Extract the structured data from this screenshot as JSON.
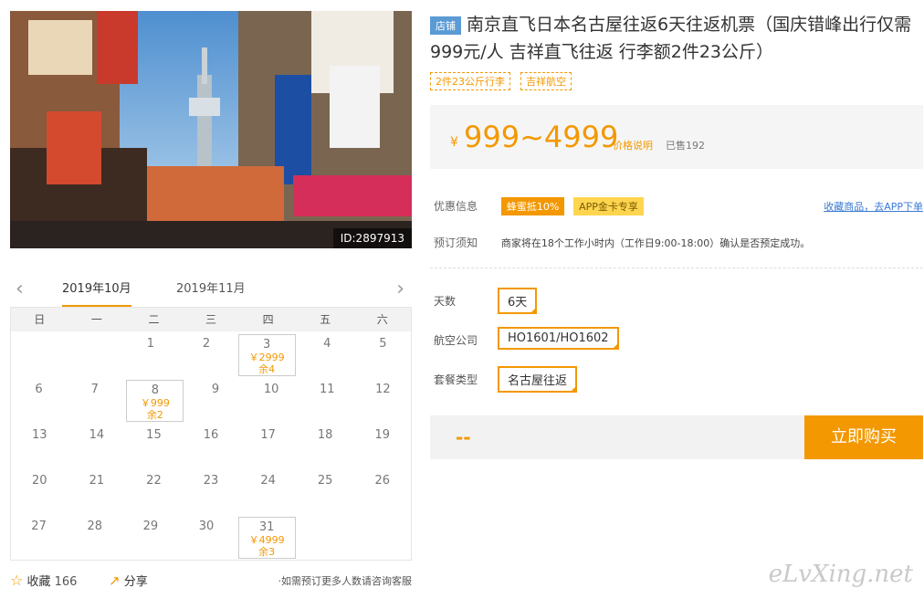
{
  "photo": {
    "id_label": "ID:2897913"
  },
  "calendar": {
    "tab_active": "2019年10月",
    "tab_next": "2019年11月",
    "weekdays": [
      "日",
      "一",
      "二",
      "三",
      "四",
      "五",
      "六"
    ],
    "days": [
      "1",
      "2",
      "3",
      "4",
      "5",
      "6",
      "7",
      "8",
      "9",
      "10",
      "11",
      "12",
      "13",
      "14",
      "15",
      "16",
      "17",
      "18",
      "19",
      "20",
      "21",
      "22",
      "23",
      "24",
      "25",
      "26",
      "27",
      "28",
      "29",
      "30",
      "31"
    ],
    "price_3": "￥2999",
    "left_3": "余4",
    "price_8": "￥999",
    "left_8": "余2",
    "price_31": "￥4999",
    "left_31": "余3"
  },
  "footer": {
    "fav_label": "收藏",
    "fav_count": "166",
    "share_label": "分享",
    "note": "·如需预订更多人数请咨询客服"
  },
  "product": {
    "shop_badge": "店铺",
    "title": "南京直飞日本名古屋往返6天往返机票（国庆错峰出行仅需999元/人 吉祥直飞往返 行李额2件23公斤）",
    "tags": [
      "2件23公斤行李",
      "吉祥航空"
    ]
  },
  "price": {
    "currency": "¥",
    "range": "999~4999",
    "explain": "价格说明",
    "sold": "已售192"
  },
  "promo": {
    "label": "优惠信息",
    "badge1": "蜂蜜抵10%",
    "badge2": "APP金卡专享",
    "app_link": "收藏商品，去APP下单"
  },
  "notice": {
    "label": "预订须知",
    "text": "商家将在18个工作小时内（工作日9:00-18:00）确认是否预定成功。"
  },
  "options": {
    "days_label": "天数",
    "days_value": "6天",
    "airline_label": "航空公司",
    "airline_value": "HO1601/HO1602",
    "package_label": "套餐类型",
    "package_value": "名古屋往返"
  },
  "buy": {
    "total": "--",
    "button": "立即购买"
  },
  "watermark": "eLvXing.net"
}
